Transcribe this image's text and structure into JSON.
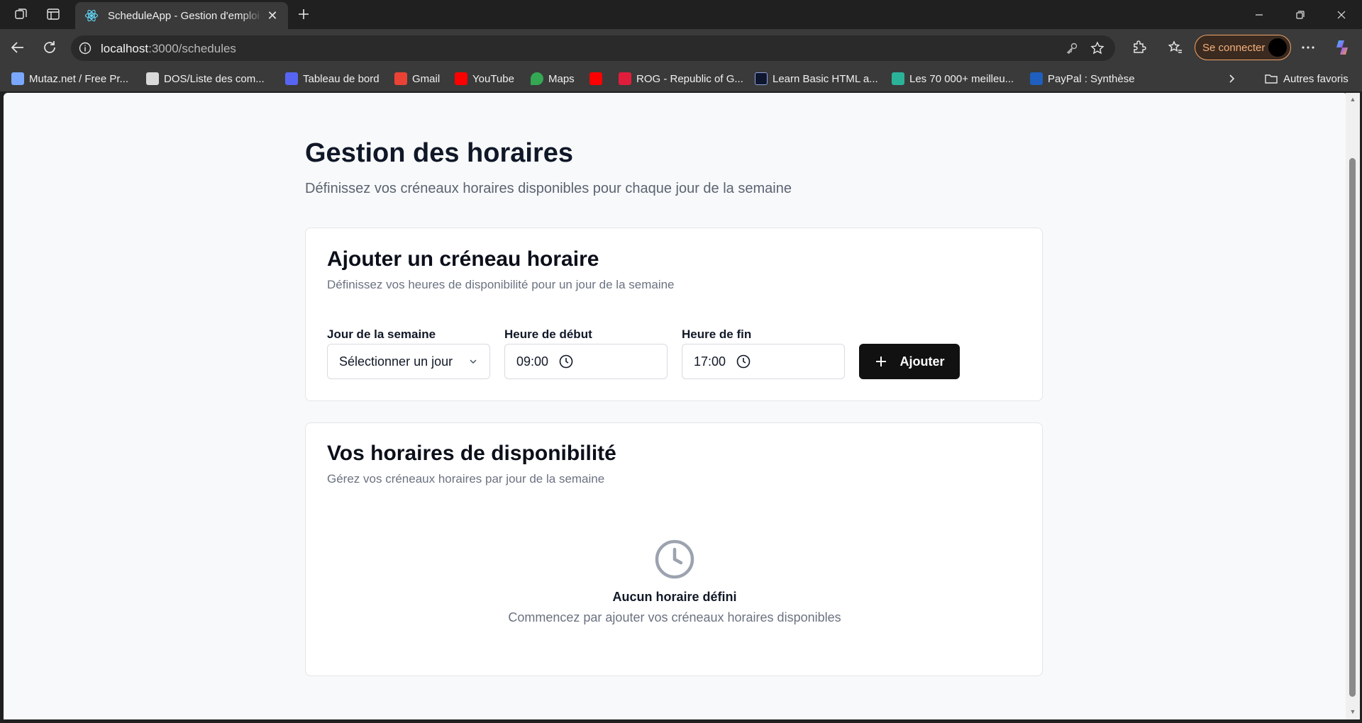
{
  "browser": {
    "tab_title": "ScheduleApp - Gestion d'emploi du temps",
    "url_host": "localhost",
    "url_path": ":3000/schedules",
    "signin_label": "Se connecter",
    "bookmarks": [
      {
        "label": "Mutaz.net / Free Pr...",
        "icon": "mountain-icon",
        "color": "#7aa7ff"
      },
      {
        "label": "DOS/Liste des com...",
        "icon": "folder-stack-icon",
        "color": "#d9d9d9"
      },
      {
        "label": "Tableau de bord",
        "icon": "dashboard-icon",
        "color": "#5865f2"
      },
      {
        "label": "Gmail",
        "icon": "gmail-icon",
        "color": "#ea4335"
      },
      {
        "label": "YouTube",
        "icon": "youtube-icon",
        "color": "#ff0000"
      },
      {
        "label": "Maps",
        "icon": "maps-pin-icon",
        "color": "#34a853"
      },
      {
        "label": "",
        "icon": "youtube-icon",
        "color": "#ff0000"
      },
      {
        "label": "ROG - Republic of G...",
        "icon": "rog-icon",
        "color": "#e01e3c"
      },
      {
        "label": "Learn Basic HTML a...",
        "icon": "learn-html-icon",
        "color": "#0f1730"
      },
      {
        "label": "Les 70 000+ meilleu...",
        "icon": "d-letter-icon",
        "color": "#2bb39a"
      },
      {
        "label": "PayPal : Synthèse",
        "icon": "paypal-icon",
        "color": "#1f5fbf"
      }
    ],
    "other_favorites": "Autres favoris"
  },
  "page": {
    "title": "Gestion des horaires",
    "subtitle": "Définissez vos créneaux horaires disponibles pour chaque jour de la semaine"
  },
  "add_card": {
    "title": "Ajouter un créneau horaire",
    "description": "Définissez vos heures de disponibilité pour un jour de la semaine",
    "day_label": "Jour de la semaine",
    "day_placeholder": "Sélectionner un jour",
    "start_label": "Heure de début",
    "start_value": "09:00",
    "end_label": "Heure de fin",
    "end_value": "17:00",
    "add_button": "Ajouter"
  },
  "list_card": {
    "title": "Vos horaires de disponibilité",
    "description": "Gérez vos créneaux horaires par jour de la semaine",
    "empty_title": "Aucun horaire défini",
    "empty_description": "Commencez par ajouter vos créneaux horaires disponibles"
  },
  "colors": {
    "accent": "#111111",
    "page_bg": "#f8f9fa",
    "muted_text": "#6b7280",
    "signin_orange": "#f6b07a"
  }
}
